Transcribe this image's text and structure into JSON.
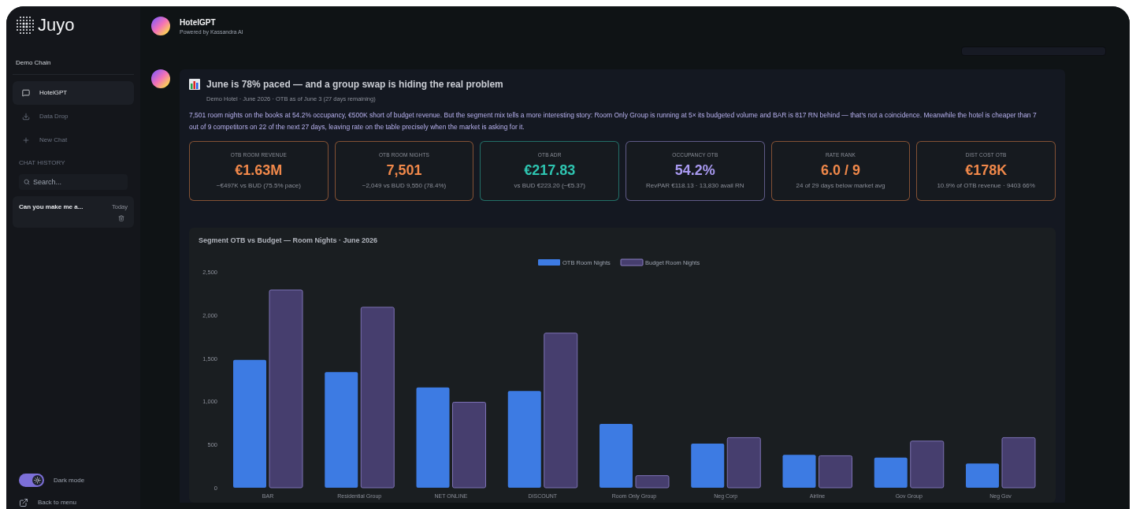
{
  "sidebar": {
    "logo": "Juyo",
    "org": "Demo Chain",
    "nav": [
      {
        "label": "HotelGPT",
        "selected": true
      },
      {
        "label": "Data Drop",
        "selected": false
      },
      {
        "label": "New Chat",
        "selected": false
      }
    ],
    "history_heading": "CHAT HISTORY",
    "search": {
      "placeholder": "Search..."
    },
    "history": [
      {
        "title": "Can you make me a...",
        "time": "Today"
      }
    ],
    "dark_mode": {
      "label": "Dark mode",
      "on": true
    },
    "back": "Back to menu"
  },
  "header": {
    "title": "HotelGPT",
    "subtitle": "Powered by Kassandra AI"
  },
  "message": {
    "title": "June is 78% paced — and a group swap is hiding the real problem",
    "meta": "Demo Hotel · June 2026 · OTB as of June 3 (27 days remaining)",
    "body": "7,501 room nights on the books at 54.2% occupancy, €500K short of budget revenue. But the segment mix tells a more interesting story: Room Only Group is running at 5× its budgeted volume and BAR is 817 RN behind — that's not a coincidence. Meanwhile the hotel is cheaper than 7 out of 9 competitors on 22 of the next 27 days, leaving rate on the table precisely when the market is asking for it.",
    "kpis": [
      {
        "label": "OTB ROOM REVENUE",
        "value": "€1.63M",
        "note": "−€497K vs BUD (75.5% pace)",
        "color": "#f0884a"
      },
      {
        "label": "OTB ROOM NIGHTS",
        "value": "7,501",
        "note": "−2,049 vs BUD 9,550 (78.4%)",
        "color": "#f0884a"
      },
      {
        "label": "OTB ADR",
        "value": "€217.83",
        "note": "vs BUD €223.20 (−€5.37)",
        "color": "#2ec4b0"
      },
      {
        "label": "OCCUPANCY OTB",
        "value": "54.2%",
        "note": "RevPAR €118.13 · 13,830 avail RN",
        "color": "#a899f0"
      },
      {
        "label": "RATE RANK",
        "value": "6.0 / 9",
        "note": "24 of 29 days below market avg",
        "color": "#f0884a"
      },
      {
        "label": "DIST COST OTB",
        "value": "€178K",
        "note": "10.9% of OTB revenue · 9403 66%",
        "color": "#f0884a"
      }
    ],
    "chart": {
      "chart_data": {
        "type": "bar",
        "title": "Segment OTB vs Budget — Room Nights · June 2026",
        "categories": [
          "BAR",
          "Residential Group",
          "NET ONLINE",
          "DISCOUNT",
          "Room Only Group",
          "Neg Corp",
          "Airline",
          "Gov Group",
          "Neg Gov"
        ],
        "series": [
          {
            "name": "OTB Room Nights",
            "color": "#3d7be3",
            "values": [
              1480,
              1340,
              1160,
              1120,
              740,
              510,
              380,
              350,
              280
            ]
          },
          {
            "name": "Budget Room Nights",
            "color": "#463e6e",
            "values": [
              2290,
              2090,
              990,
              1790,
              140,
              580,
              370,
              540,
              580
            ]
          }
        ],
        "legend": "top",
        "ylim": [
          0,
          2500
        ],
        "yticks": [
          {
            "value": 0,
            "label": "0"
          },
          {
            "value": 500,
            "label": "500"
          },
          {
            "value": 1000,
            "label": "1,000"
          },
          {
            "value": 1500,
            "label": "1,500"
          },
          {
            "value": 2000,
            "label": "2,000"
          },
          {
            "value": 2500,
            "label": "2,500"
          }
        ]
      }
    }
  }
}
